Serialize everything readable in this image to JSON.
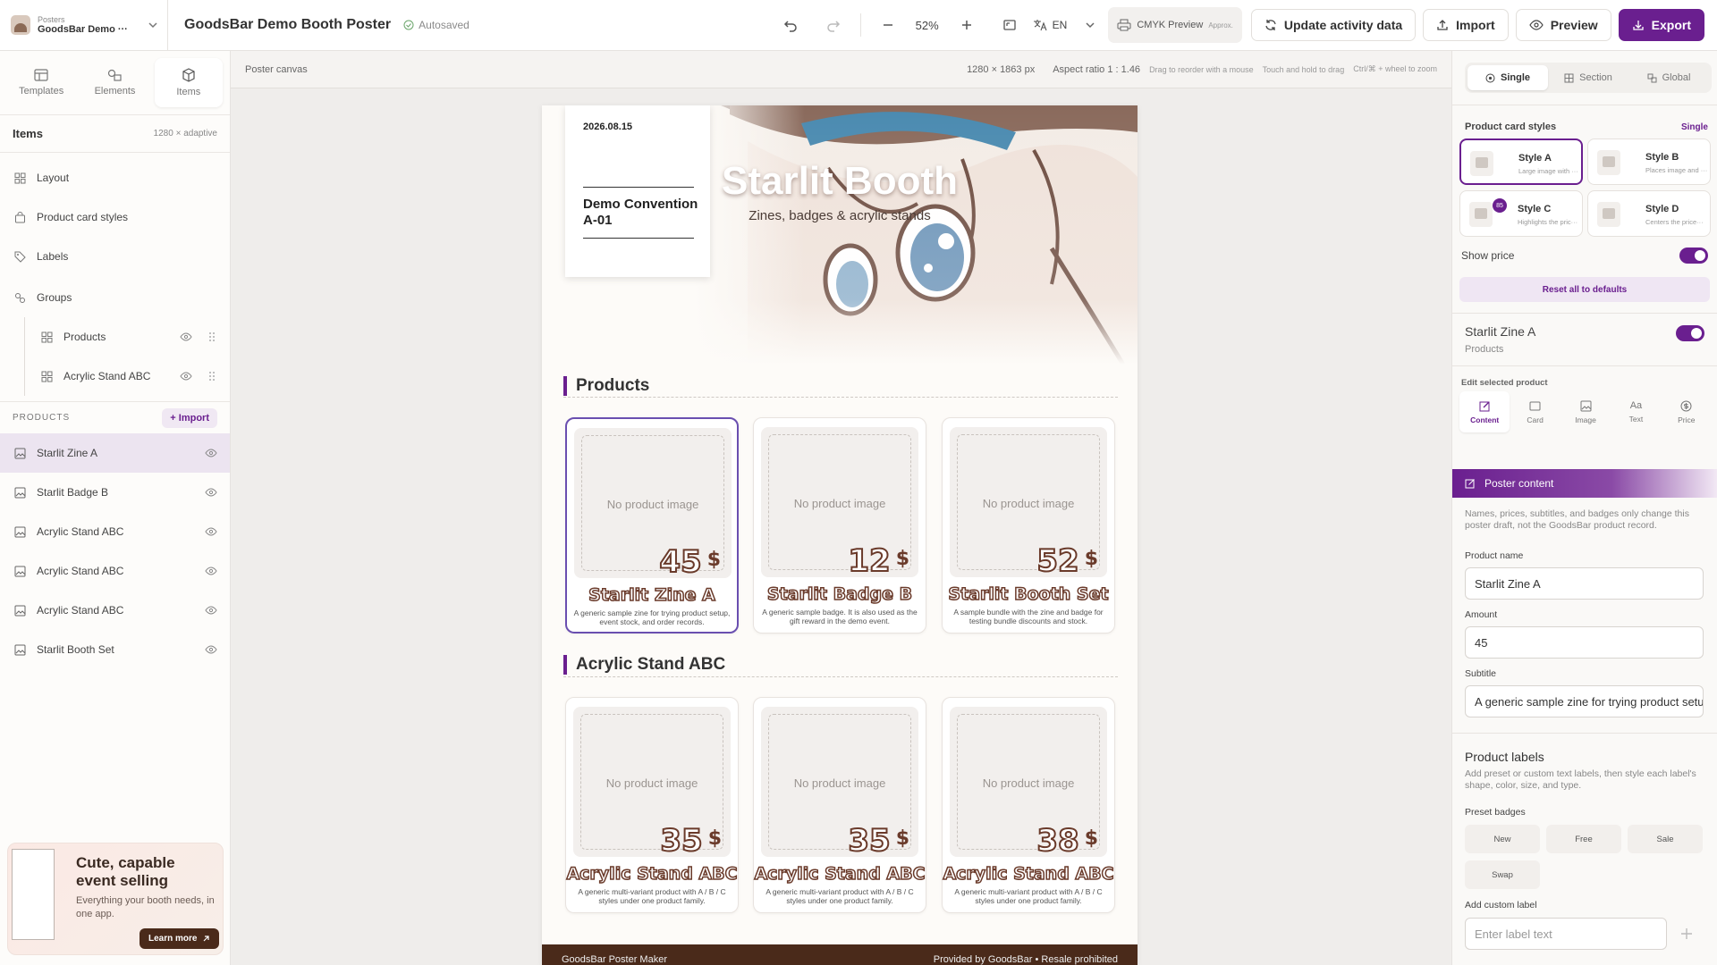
{
  "project": {
    "label": "Posters",
    "name": "GoodsBar Demo ···"
  },
  "doc_title": "GoodsBar Demo Booth Poster",
  "autosave": "Autosaved",
  "toolbar": {
    "zoom": "52%",
    "lang": "EN",
    "cmyk": "CMYK Preview",
    "cmyk_note": "Approx.",
    "update": "Update activity data",
    "import": "Import",
    "preview": "Preview",
    "export": "Export"
  },
  "left_tabs": [
    "Templates",
    "Elements",
    "Items"
  ],
  "items_panel": {
    "title": "Items",
    "size": "1280 × adaptive",
    "layout": "Layout",
    "card_styles": "Product card styles",
    "labels": "Labels",
    "groups": "Groups",
    "group_items": [
      "Products",
      "Acrylic Stand ABC"
    ]
  },
  "products_section": {
    "title": "PRODUCTS",
    "import": "Import",
    "items": [
      "Starlit Zine A",
      "Starlit Badge B",
      "Acrylic Stand ABC",
      "Acrylic Stand ABC",
      "Acrylic Stand ABC",
      "Starlit Booth Set"
    ]
  },
  "promo": {
    "title": "Cute, capable event selling",
    "body": "Everything your booth needs, in one app.",
    "cta": "Learn more"
  },
  "canvas": {
    "title": "Poster canvas",
    "dims": "1280 × 1863 px",
    "aspect": "Aspect ratio 1 : 1.46",
    "hints": [
      "Drag to reorder with a mouse",
      "Touch and hold to drag",
      "Ctrl/⌘ + wheel to zoom"
    ]
  },
  "poster": {
    "date": "2026.08.15",
    "event": "Demo Convention A-01",
    "title": "Starlit Booth",
    "subtitle": "Zines, badges & acrylic stands",
    "sections": [
      {
        "title": "Products",
        "cards": [
          {
            "noimg": "No product image",
            "price": "45",
            "cur": "$",
            "name": "Starlit Zine A",
            "desc": "A generic sample zine for trying product setup, event stock, and order records."
          },
          {
            "noimg": "No product image",
            "price": "12",
            "cur": "$",
            "name": "Starlit Badge B",
            "desc": "A generic sample badge. It is also used as the gift reward in the demo event."
          },
          {
            "noimg": "No product image",
            "price": "52",
            "cur": "$",
            "name": "Starlit Booth Set",
            "desc": "A sample bundle with the zine and badge for testing bundle discounts and stock."
          }
        ]
      },
      {
        "title": "Acrylic Stand ABC",
        "cards": [
          {
            "noimg": "No product image",
            "price": "35",
            "cur": "$",
            "name": "Acrylic Stand ABC",
            "desc": "A generic multi-variant product with A / B / C styles under one product family."
          },
          {
            "noimg": "No product image",
            "price": "35",
            "cur": "$",
            "name": "Acrylic Stand ABC",
            "desc": "A generic multi-variant product with A / B / C styles under one product family."
          },
          {
            "noimg": "No product image",
            "price": "38",
            "cur": "$",
            "name": "Acrylic Stand ABC",
            "desc": "A generic multi-variant product with A / B / C styles under one product family."
          }
        ]
      }
    ],
    "footer_left": "GoodsBar Poster Maker",
    "footer_right": "Provided by GoodsBar • Resale prohibited"
  },
  "right": {
    "modes": [
      "Single",
      "Section",
      "Global"
    ],
    "card_styles_label": "Product card styles",
    "card_styles_scope": "Single",
    "styles": [
      {
        "name": "Style A",
        "desc": "Large image with ···"
      },
      {
        "name": "Style B",
        "desc": "Places image and ···"
      },
      {
        "name": "Style C",
        "desc": "Highlights the pric···"
      },
      {
        "name": "Style D",
        "desc": "Centers the price···"
      }
    ],
    "style_c_badge": "85",
    "show_price": "Show price",
    "reset": "Reset all to defaults",
    "selected": {
      "name": "Starlit Zine A",
      "group": "Products"
    },
    "edit_label": "Edit selected product",
    "edit_tabs": [
      "Content",
      "Card",
      "Image",
      "Text",
      "Price"
    ],
    "poster_content": "Poster content",
    "poster_note": "Names, prices, subtitles, and badges only change this poster draft, not the GoodsBar product record.",
    "fields": {
      "name_label": "Product name",
      "name_value": "Starlit Zine A",
      "amount_label": "Amount",
      "amount_value": "45",
      "subtitle_label": "Subtitle",
      "subtitle_value": "A generic sample zine for trying product setu"
    },
    "labels_title": "Product labels",
    "labels_note": "Add preset or custom text labels, then style each label's shape, color, size, and type.",
    "preset_label": "Preset badges",
    "presets": [
      "New",
      "Free",
      "Sale",
      "Swap"
    ],
    "custom_label": "Add custom label",
    "custom_placeholder": "Enter label text"
  },
  "colors": {
    "accent": "#6a1f8f",
    "footer": "#4a2a1a",
    "price_outline": "#6a3a2a"
  }
}
